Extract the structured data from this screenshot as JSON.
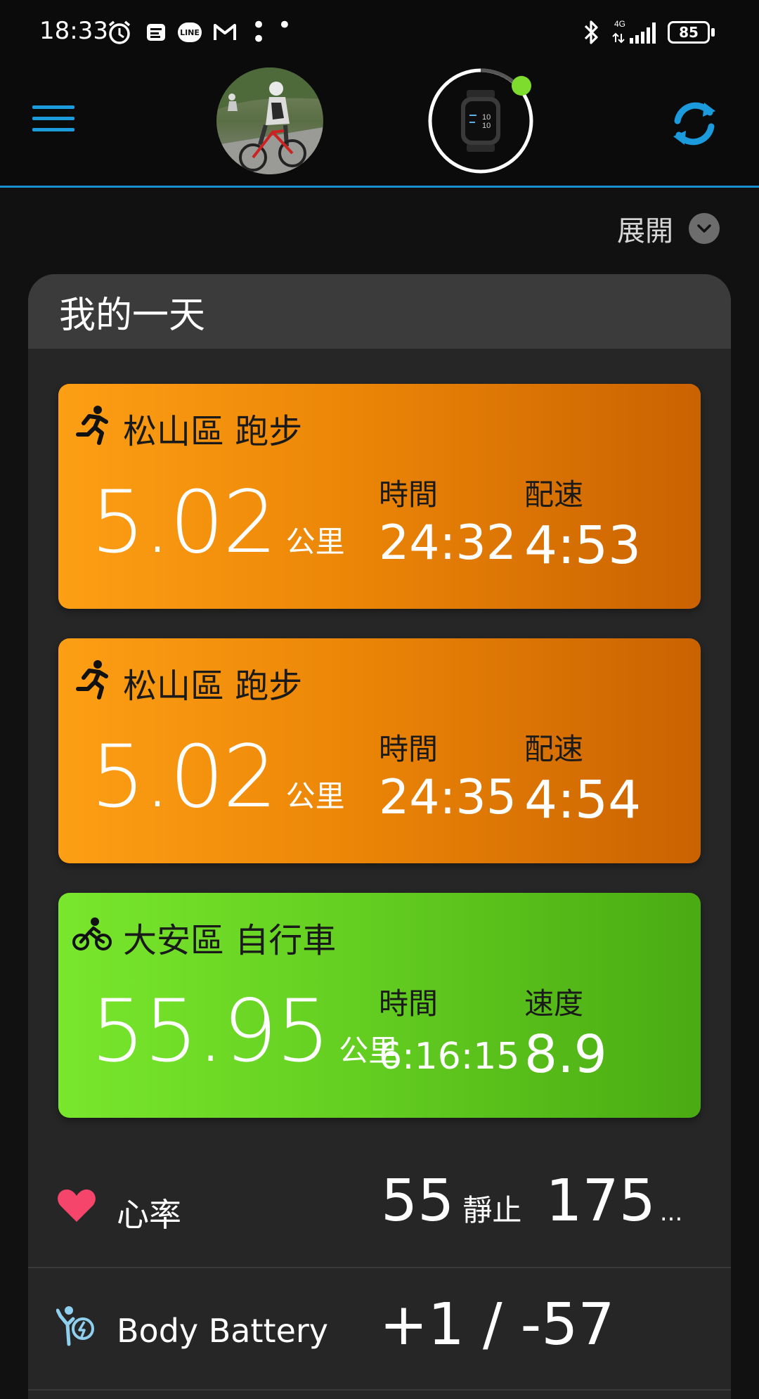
{
  "status_bar": {
    "time": "18:33",
    "network": "4G",
    "battery": "85",
    "line_badge": "LINE",
    "overflow": "• • •"
  },
  "header": {
    "menu_icon": "hamburger-menu-icon",
    "avatar": "profile-avatar",
    "device": "smartwatch-device",
    "device_status_color": "#7ddc2e",
    "sync_icon": "sync-icon",
    "accent_color": "#1b9bdb"
  },
  "expand": {
    "label": "展開"
  },
  "my_day": {
    "title": "我的一天",
    "activities": [
      {
        "type": "run",
        "title": "松山區 跑步",
        "distance": "5.02",
        "unit": "公里",
        "stat1_label": "時間",
        "stat1_value": "24:32",
        "stat2_label": "配速",
        "stat2_value": "4:53"
      },
      {
        "type": "run",
        "title": "松山區 跑步",
        "distance": "5.02",
        "unit": "公里",
        "stat1_label": "時間",
        "stat1_value": "24:35",
        "stat2_label": "配速",
        "stat2_value": "4:54"
      },
      {
        "type": "bike",
        "title": "大安區 自行車",
        "distance": "55.95",
        "unit": "公里",
        "stat1_label": "時間",
        "stat1_value": "6:16:15",
        "stat2_label": "速度",
        "stat2_value": "8.9"
      }
    ],
    "heart_rate": {
      "label": "心率",
      "resting": "55",
      "resting_label": "靜止",
      "max": "175",
      "ellipsis": "..."
    },
    "body_battery": {
      "label": "Body Battery",
      "value": "+1 / -57"
    }
  }
}
